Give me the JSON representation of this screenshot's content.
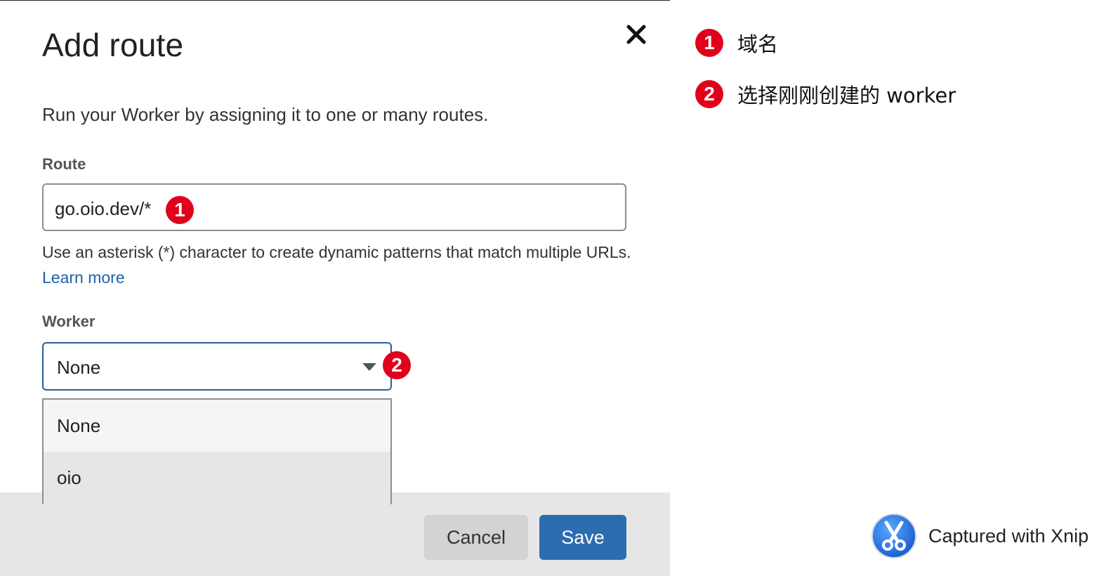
{
  "dialog": {
    "title": "Add route",
    "description": "Run your Worker by assigning it to one or many routes.",
    "close_icon": "close-icon"
  },
  "route": {
    "label": "Route",
    "value": "go.oio.dev/*",
    "help_text": "Use an asterisk (*) character to create dynamic patterns that match multiple URLs.",
    "help_link": "Learn more"
  },
  "worker": {
    "label": "Worker",
    "selected": "None",
    "options": [
      "None",
      "oio"
    ]
  },
  "footer": {
    "cancel_label": "Cancel",
    "save_label": "Save"
  },
  "annotations": {
    "markers": [
      "1",
      "2"
    ],
    "legend": [
      {
        "number": "1",
        "text": "域名"
      },
      {
        "number": "2",
        "text": "选择刚刚创建的 worker"
      }
    ],
    "marker_color": "#e0001b"
  },
  "watermark": {
    "text": "Captured with Xnip",
    "icon": "xnip-scissors-icon"
  },
  "colors": {
    "link": "#2261a8",
    "primary_button": "#2c6db0",
    "select_focus_border": "#2a5d9c"
  }
}
